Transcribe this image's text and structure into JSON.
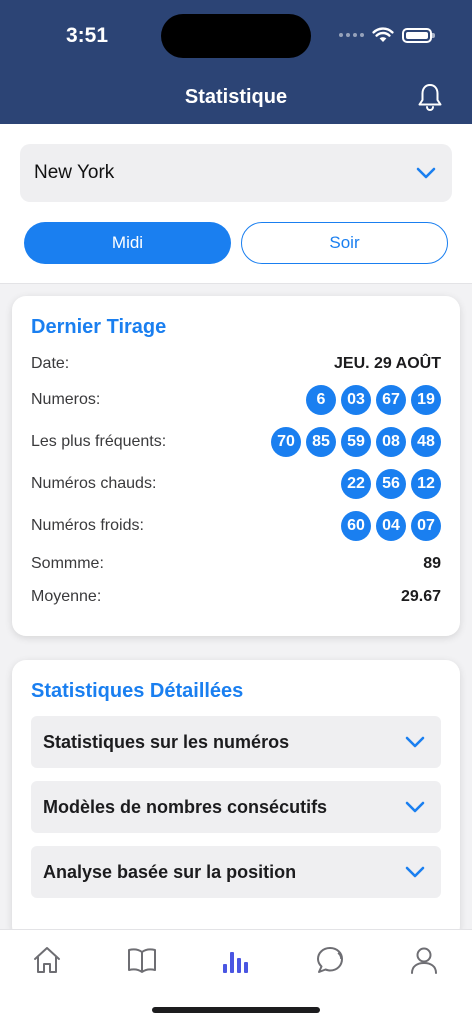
{
  "status_bar": {
    "time": "3:51"
  },
  "header": {
    "title": "Statistique"
  },
  "selector": {
    "location": "New York",
    "draw_times": [
      {
        "label": "Midi",
        "active": true
      },
      {
        "label": "Soir",
        "active": false
      }
    ]
  },
  "last_draw": {
    "title": "Dernier Tirage",
    "date_label": "Date:",
    "date_value": "JEU. 29 AOÛT",
    "numbers_label": "Numeros:",
    "numbers": [
      "6",
      "03",
      "67",
      "19"
    ],
    "frequent_label": "Les plus fréquents:",
    "frequent": [
      "70",
      "85",
      "59",
      "08",
      "48"
    ],
    "hot_label": "Numéros chauds:",
    "hot": [
      "22",
      "56",
      "12"
    ],
    "cold_label": "Numéros froids:",
    "cold": [
      "60",
      "04",
      "07"
    ],
    "sum_label": "Sommme:",
    "sum_value": "89",
    "average_label": "Moyenne:",
    "average_value": "29.67"
  },
  "detailed": {
    "title": "Statistiques Détaillées",
    "sections": [
      "Statistiques sur les numéros",
      "Modèles de nombres consécutifs",
      "Analyse basée sur la position"
    ]
  },
  "tabbar": {
    "items": [
      {
        "icon": "home-icon",
        "active": false
      },
      {
        "icon": "book-icon",
        "active": false
      },
      {
        "icon": "bar-chart-icon",
        "active": true
      },
      {
        "icon": "chat-icon",
        "active": false
      },
      {
        "icon": "profile-icon",
        "active": false
      }
    ]
  },
  "colors": {
    "header_bg": "#2c4475",
    "accent": "#1a7ff0",
    "tab_active": "#4a56e2",
    "tab_inactive": "#6e6e73"
  }
}
